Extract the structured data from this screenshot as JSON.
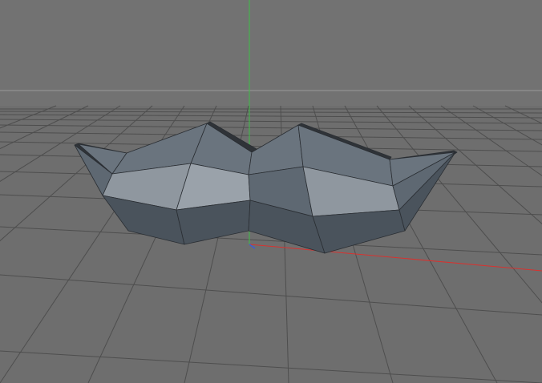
{
  "viewport": {
    "colors": {
      "sky": "#727272",
      "floor": "#6e6e6e",
      "grid": "#4e4e4e",
      "horizon": "#9a9a9a",
      "axis_x": "#d8322f",
      "axis_y": "#3fbf45",
      "axis_z": "#3d5bd8",
      "edge": "#2a2e33"
    },
    "model": {
      "icon": "mustache-model",
      "shades": {
        "dark": "#4a535c",
        "mid": "#5e6872",
        "light": "#8f979f",
        "lighter": "#9aa2aa",
        "top": "#6a747e",
        "rim": "#2f3338"
      }
    }
  }
}
